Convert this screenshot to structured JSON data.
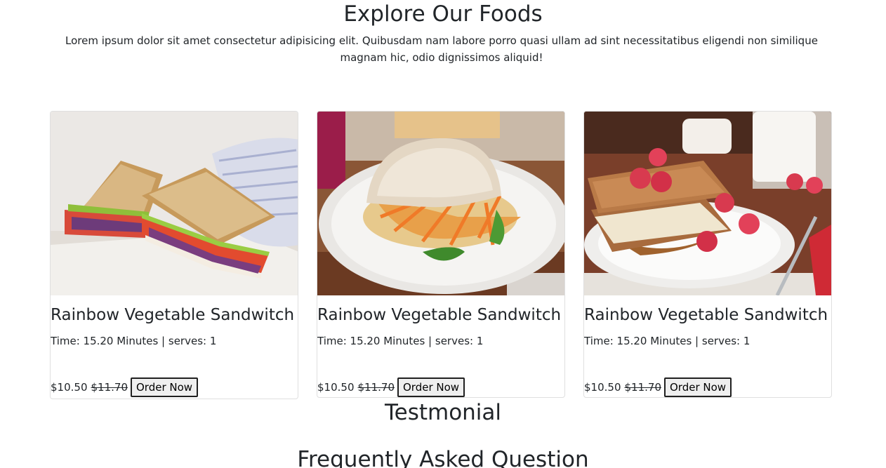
{
  "explore": {
    "title": "Explore Our Foods",
    "intro": "Lorem ipsum dolor sit amet consectetur adipisicing elit. Quibusdam nam labore porro quasi ullam ad sint necessitatibus eligendi non similique magnam hic, odio dignissimos aliquid!"
  },
  "foods": [
    {
      "image": "sandwich-triangle-photo",
      "name": "Rainbow Vegetable Sandwitch",
      "meta": "Time: 15.20 Minutes | serves: 1",
      "price": "$10.50",
      "old_price": "$11.70",
      "button": "Order Now"
    },
    {
      "image": "ciabatta-sandwich-photo",
      "name": "Rainbow Vegetable Sandwitch",
      "meta": "Time: 15.20 Minutes | serves: 1",
      "price": "$10.50",
      "old_price": "$11.70",
      "button": "Order Now"
    },
    {
      "image": "raspberry-french-toast-photo",
      "name": "Rainbow Vegetable Sandwitch",
      "meta": "Time: 15.20 Minutes | serves: 1",
      "price": "$10.50",
      "old_price": "$11.70",
      "button": "Order Now"
    }
  ],
  "testimonial": {
    "title": "Testmonial"
  },
  "faq": {
    "title": "Frequently Asked Question"
  }
}
